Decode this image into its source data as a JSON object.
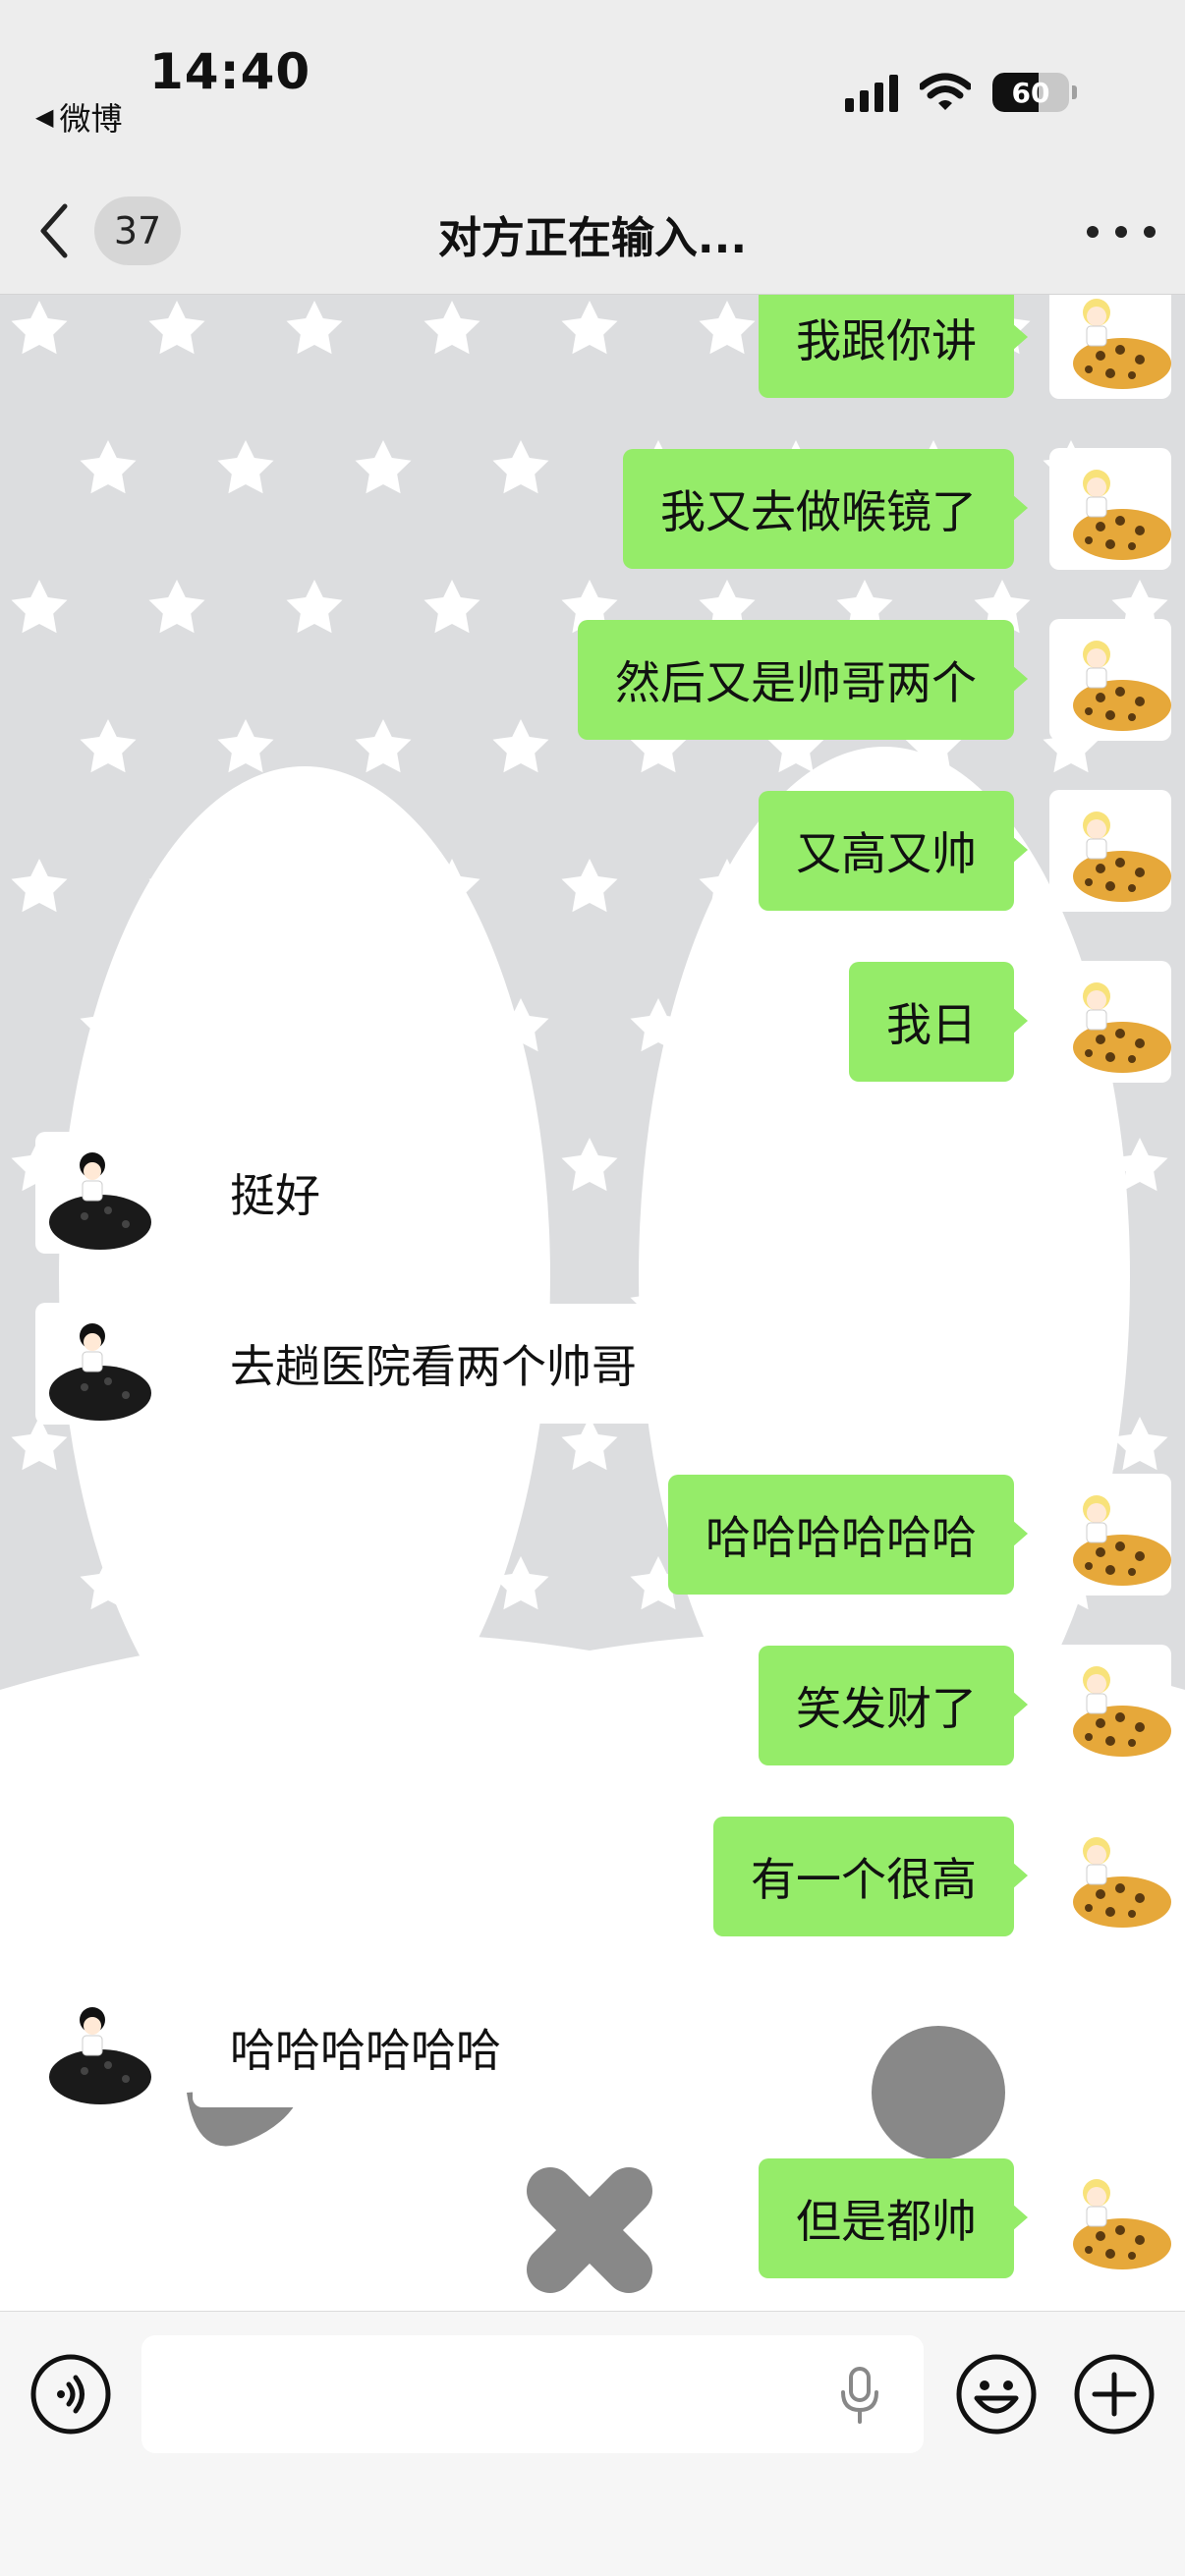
{
  "status_bar": {
    "time": "14:40",
    "back_app": "微博",
    "battery_level": "60",
    "battery_fraction": 0.6,
    "icons": [
      "signal-icon",
      "wifi-icon",
      "battery-icon"
    ]
  },
  "nav": {
    "unread_count": "37",
    "title": "对方正在输入...",
    "icons": [
      "chevron-left-icon",
      "more-icon"
    ]
  },
  "messages": [
    {
      "side": "out",
      "text": "我跟你讲"
    },
    {
      "side": "out",
      "text": "我又去做喉镜了"
    },
    {
      "side": "out",
      "text": "然后又是帅哥两个"
    },
    {
      "side": "out",
      "text": "又高又帅"
    },
    {
      "side": "out",
      "text": "我日"
    },
    {
      "side": "in",
      "text": "挺好"
    },
    {
      "side": "in",
      "text": "去趟医院看两个帅哥"
    },
    {
      "side": "out",
      "text": "哈哈哈哈哈哈"
    },
    {
      "side": "out",
      "text": "笑发财了"
    },
    {
      "side": "out",
      "text": "有一个很高"
    },
    {
      "side": "in",
      "text": "哈哈哈哈哈哈"
    },
    {
      "side": "out",
      "text": "但是都帅"
    }
  ],
  "input_bar": {
    "icons": [
      "voice-icon",
      "mic-icon",
      "emoji-icon",
      "plus-icon"
    ]
  },
  "colors": {
    "outgoing_bubble": "#95ec69",
    "incoming_bubble": "#ffffff",
    "background": "#ededed"
  }
}
